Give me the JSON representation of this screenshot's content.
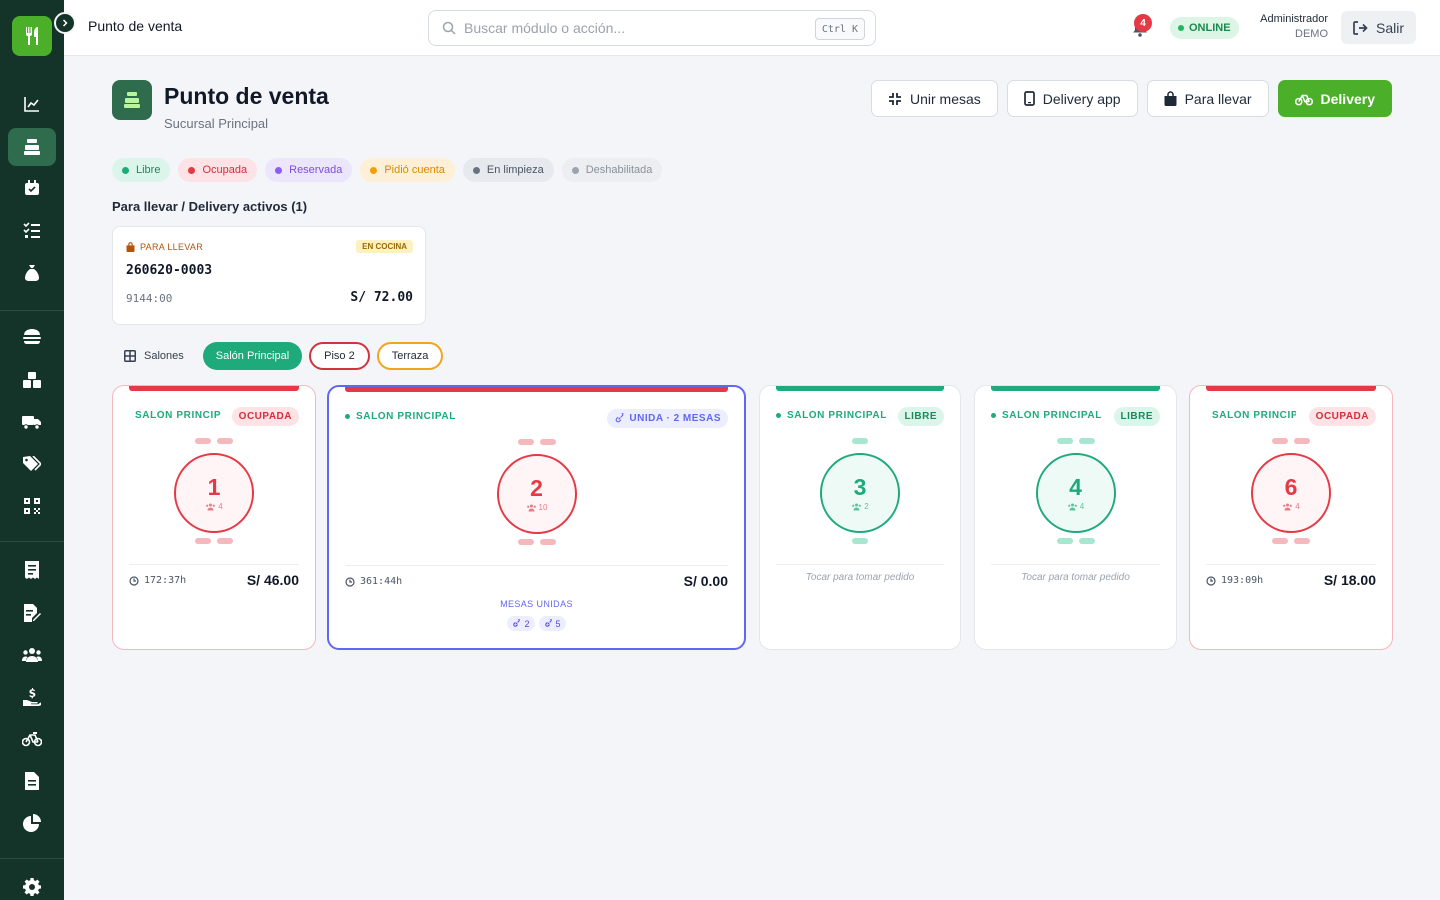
{
  "topbar": {
    "title": "Punto de venta",
    "search_placeholder": "Buscar módulo o acción...",
    "shortcut": "Ctrl K",
    "notifications": "4",
    "status": "ONLINE",
    "user_role": "Administrador",
    "user_company": "DEMO",
    "logout": "Salir"
  },
  "header": {
    "title": "Punto de venta",
    "subtitle": "Sucursal Principal",
    "actions": [
      "Unir mesas",
      "Delivery app",
      "Para llevar",
      "Delivery"
    ]
  },
  "legend": [
    {
      "label": "Libre",
      "color": "#1eaa7b",
      "bg": "#dcf5ea",
      "text": "#1a8a5e"
    },
    {
      "label": "Ocupada",
      "color": "#e63946",
      "bg": "#fde3e5",
      "text": "#d02f3c"
    },
    {
      "label": "Reservada",
      "color": "#8b5cf6",
      "bg": "#ece6fd",
      "text": "#7c4ddb"
    },
    {
      "label": "Pidió cuenta",
      "color": "#f59e0b",
      "bg": "#fdf0d6",
      "text": "#d98a00"
    },
    {
      "label": "En limpieza",
      "color": "#6b7280",
      "bg": "#e6e9ee",
      "text": "#4b5563"
    },
    {
      "label": "Deshabilitada",
      "color": "#9ca3af",
      "bg": "#eceef1",
      "text": "#8a919b"
    }
  ],
  "active_orders": {
    "title": "Para llevar / Delivery activos (1)",
    "orders": [
      {
        "type": "PARA LLEVAR",
        "status": "EN COCINA",
        "code": "260620-0003",
        "elapsed": "9144:00",
        "total": "S/ 72.00"
      }
    ]
  },
  "salons": {
    "label": "Salones",
    "tabs": [
      "Salón Principal",
      "Piso 2",
      "Terraza"
    ],
    "active": 0
  },
  "tables": [
    {
      "salon": "SALÓN PRINCIPAL",
      "status": "OCUPADA",
      "number": "1",
      "seats": "4",
      "elapsed": "172:37h",
      "total": "S/ 46.00"
    },
    {
      "salon": "SALÓN PRINCIPAL",
      "status": "UNIDA · 2 MESAS",
      "number": "2",
      "seats": "10",
      "elapsed": "361:44h",
      "total": "S/ 0.00",
      "linked_label": "MESAS UNIDAS",
      "linked": [
        "2",
        "5"
      ]
    },
    {
      "salon": "SALÓN PRINCIPAL",
      "status": "LIBRE",
      "number": "3",
      "seats": "2",
      "hint": "Tocar para tomar pedido"
    },
    {
      "salon": "SALÓN PRINCIPAL",
      "status": "LIBRE",
      "number": "4",
      "seats": "4",
      "hint": "Tocar para tomar pedido"
    },
    {
      "salon": "SALÓN PRINCIPAL",
      "status": "OCUPADA",
      "number": "6",
      "seats": "4",
      "elapsed": "193:09h",
      "total": "S/ 18.00"
    }
  ],
  "colors": {
    "brand": "#4caf2a",
    "sidebar": "#14342a",
    "free": "#1eaa7b",
    "busy": "#e63946",
    "linked": "#6366f1"
  },
  "sidebar_icons": [
    "chart-line-icon",
    "cash-register-icon",
    "calendar-check-icon",
    "list-check-icon",
    "money-bag-icon",
    "burger-icon",
    "boxes-icon",
    "truck-icon",
    "tags-icon",
    "qrcode-icon",
    "receipt-icon",
    "file-edit-icon",
    "users-icon",
    "hand-dollar-icon",
    "bicycle-icon",
    "document-icon",
    "pie-chart-icon",
    "gear-icon"
  ]
}
